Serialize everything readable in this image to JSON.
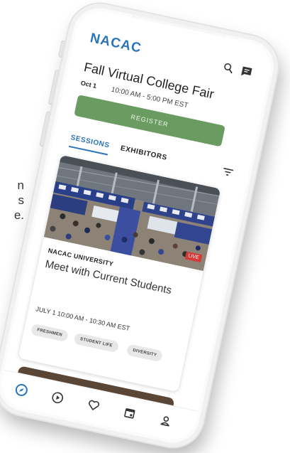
{
  "side_text": [
    "n",
    "s",
    "e."
  ],
  "app": {
    "logo": "NACAC"
  },
  "header": {
    "search_icon": "search-icon",
    "chat_icon": "chat-icon"
  },
  "event": {
    "title": "Fall Virtual College Fair",
    "date": "Oct 1",
    "time": "10:00 AM - 5:00 PM EST",
    "register_label": "REGISTER"
  },
  "tabs": [
    {
      "label": "SESSIONS",
      "active": true
    },
    {
      "label": "EXHIBITORS",
      "active": false
    }
  ],
  "filter_icon": "filter-icon",
  "session": {
    "badge": "LIVE",
    "organization": "NACAC UNIVERSITY",
    "title": "Meet with Current Students",
    "time": "JULY 1 10:00 AM - 10:30 AM EST",
    "tags": [
      "FRESHMEN",
      "STUDENT LIFE",
      "DIVERSITY"
    ]
  },
  "nav": {
    "items": [
      "compass-icon",
      "play-icon",
      "heart-icon",
      "calendar-icon",
      "profile-icon"
    ],
    "active_color": "#2a75b8"
  },
  "colors": {
    "brand": "#2a75b8",
    "register": "#6a9c62",
    "live": "#d43a3a"
  }
}
